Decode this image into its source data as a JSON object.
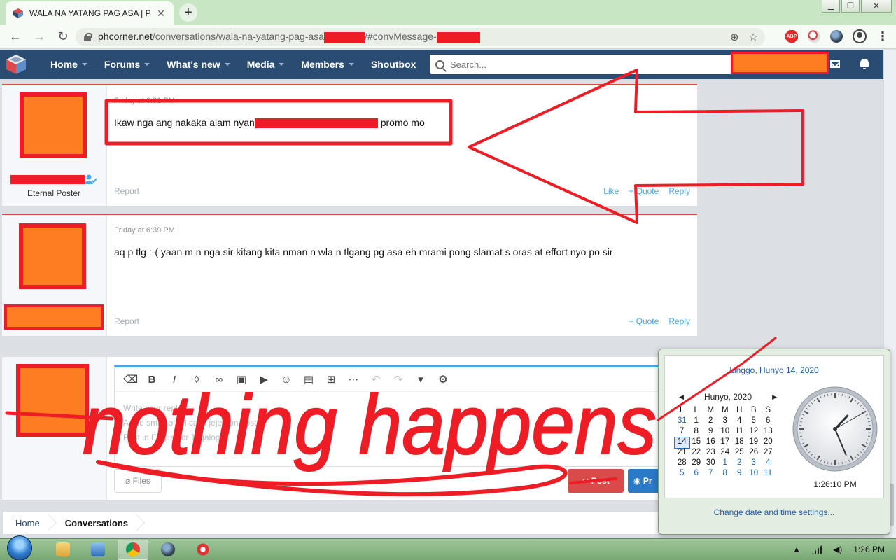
{
  "browser": {
    "tab_title": "WALA NA YATANG PAG ASA | P...",
    "tab_close": "✕",
    "new_tab": "+",
    "url_host": "phcorner.net",
    "url_path": "/conversations/wala-na-yatang-pag-asa",
    "url_mid": "/#convMessage-",
    "abp_label": "ABP"
  },
  "site_nav": {
    "items": [
      {
        "label": "Home"
      },
      {
        "label": "Forums"
      },
      {
        "label": "What's new"
      },
      {
        "label": "Media"
      },
      {
        "label": "Members"
      },
      {
        "label": "Shoutbox"
      }
    ],
    "search_placeholder": "Search..."
  },
  "messages": [
    {
      "time": "Friday at 6:31 PM",
      "body_before": "Ikaw nga ang nakaka alam nyan",
      "body_after": "promo mo",
      "user_title": "Eternal Poster",
      "report": "Report",
      "actions": [
        "Like",
        "+ Quote",
        "Reply"
      ]
    },
    {
      "time": "Friday at 6:39 PM",
      "body": "aq p tlg :-( yaan m n nga sir kitang kita nman n wla n tlgang pg asa eh mrami pong slamat s oras at effort nyo po sir",
      "report": "Report",
      "actions": [
        "+ Quote",
        "Reply"
      ]
    }
  ],
  "editor": {
    "placeholder_lines": [
      "Write your reply...",
      "Avoid small or all caps jejemon posts.",
      "Post in English or Tagalog."
    ],
    "files_label": "Files",
    "post_label": "Post",
    "preview_label": "Pr"
  },
  "breadcrumb": [
    "Home",
    "Conversations"
  ],
  "calendar": {
    "long_date": "Linggo, Hunyo 14, 2020",
    "month_label": "Hunyo, 2020",
    "prev_arrow": "◀",
    "next_arrow": "▶",
    "weekdays": [
      "L",
      "L",
      "M",
      "M",
      "H",
      "B",
      "S"
    ],
    "days": [
      "31",
      "1",
      "2",
      "3",
      "4",
      "5",
      "6",
      "7",
      "8",
      "9",
      "10",
      "11",
      "12",
      "13",
      "14",
      "15",
      "16",
      "17",
      "18",
      "19",
      "20",
      "21",
      "22",
      "23",
      "24",
      "25",
      "26",
      "27",
      "28",
      "29",
      "30",
      "1",
      "2",
      "3",
      "4",
      "5",
      "6",
      "7",
      "8",
      "9",
      "10",
      "11"
    ],
    "today": "14",
    "time": "1:26:10 PM",
    "clock_time": {
      "hour": 1,
      "minute": 26,
      "second": 10
    },
    "settings_link": "Change date and time settings..."
  },
  "taskbar": {
    "clock": "1:26 PM"
  },
  "annotation": {
    "text": "nothing happens",
    "color": "#ee1c24"
  },
  "colors": {
    "nav_bg": "#2a4b72",
    "redaction_orange": "#ff7d21",
    "redaction_red": "#ee1c24",
    "link_blue": "#47a7eb"
  }
}
